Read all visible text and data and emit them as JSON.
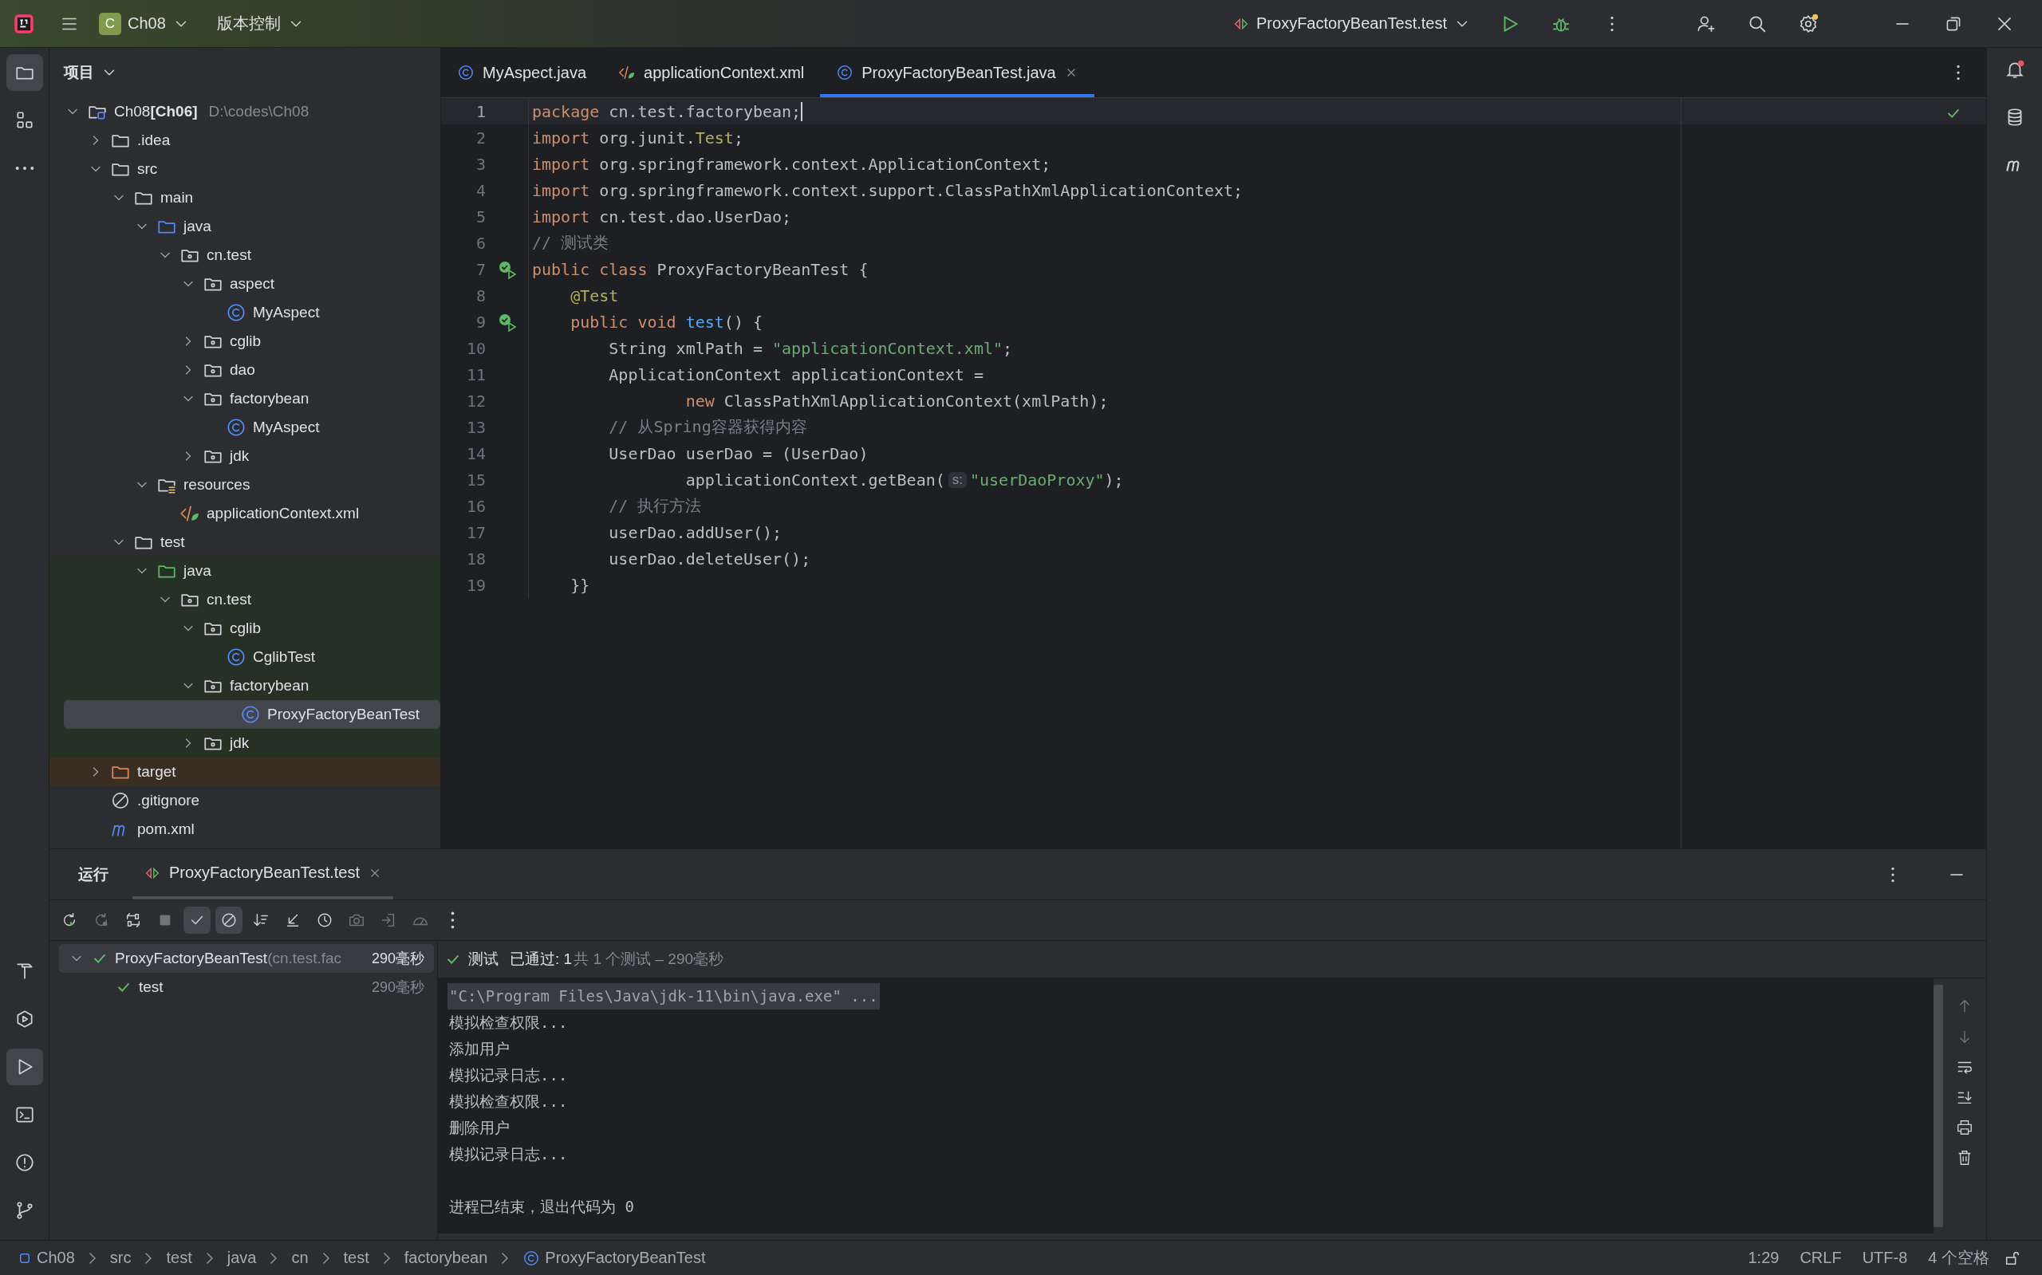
{
  "title_bar": {
    "project_badge": "C",
    "project": "Ch08",
    "vcs": "版本控制",
    "run_config": "ProxyFactoryBeanTest.test",
    "settings_notice": true
  },
  "left_toolbar": {
    "top": [
      {
        "kind": "folder",
        "selected": true
      },
      {
        "kind": "structure",
        "selected": false
      },
      {
        "kind": "more",
        "selected": false
      }
    ],
    "bottom": [
      {
        "kind": "build",
        "selected": false
      },
      {
        "kind": "services",
        "selected": false
      },
      {
        "kind": "run",
        "selected": true
      },
      {
        "kind": "terminal",
        "selected": false
      },
      {
        "kind": "problems",
        "selected": false
      },
      {
        "kind": "git",
        "selected": false
      }
    ]
  },
  "project_panel": {
    "title": "项目",
    "tree": [
      {
        "label": "Ch08",
        "module": "[Ch06]",
        "path": "D:\\codes\\Ch08",
        "kind": "module",
        "expanded": true,
        "selected": false,
        "children": [
          {
            "label": ".idea",
            "kind": "folder",
            "expanded": false,
            "selected": false
          },
          {
            "label": "src",
            "kind": "folder",
            "expanded": true,
            "selected": false,
            "children": [
              {
                "label": "main",
                "kind": "folder",
                "expanded": true,
                "selected": false,
                "children": [
                  {
                    "label": "java",
                    "kind": "src-root",
                    "expanded": true,
                    "selected": false,
                    "children": [
                      {
                        "label": "cn.test",
                        "kind": "package",
                        "expanded": true,
                        "selected": false,
                        "children": [
                          {
                            "label": "aspect",
                            "kind": "package",
                            "expanded": true,
                            "selected": false,
                            "children": [
                              {
                                "label": "MyAspect",
                                "kind": "class",
                                "selected": false
                              }
                            ]
                          },
                          {
                            "label": "cglib",
                            "kind": "package",
                            "expanded": false,
                            "selected": false
                          },
                          {
                            "label": "dao",
                            "kind": "package",
                            "expanded": false,
                            "selected": false
                          },
                          {
                            "label": "factorybean",
                            "kind": "package",
                            "expanded": true,
                            "selected": false,
                            "children": [
                              {
                                "label": "MyAspect",
                                "kind": "class",
                                "selected": false
                              }
                            ]
                          },
                          {
                            "label": "jdk",
                            "kind": "package",
                            "expanded": false,
                            "selected": false
                          }
                        ]
                      }
                    ]
                  },
                  {
                    "label": "resources",
                    "kind": "resources",
                    "expanded": true,
                    "selected": false,
                    "children": [
                      {
                        "label": "applicationContext.xml",
                        "kind": "xml",
                        "selected": false
                      }
                    ]
                  }
                ]
              },
              {
                "label": "test",
                "kind": "folder",
                "expanded": true,
                "selected": false,
                "children": [
                  {
                    "label": "java",
                    "kind": "test-root",
                    "expanded": true,
                    "selected": false,
                    "children": [
                      {
                        "label": "cn.test",
                        "kind": "package",
                        "expanded": true,
                        "selected": false,
                        "children": [
                          {
                            "label": "cglib",
                            "kind": "package",
                            "expanded": true,
                            "selected": false,
                            "children": [
                              {
                                "label": "CglibTest",
                                "kind": "class",
                                "selected": false
                              }
                            ]
                          },
                          {
                            "label": "factorybean",
                            "kind": "package",
                            "expanded": true,
                            "selected": false,
                            "children": [
                              {
                                "label": "ProxyFactoryBeanTest",
                                "kind": "class",
                                "selected": true
                              }
                            ]
                          },
                          {
                            "label": "jdk",
                            "kind": "package",
                            "expanded": false,
                            "selected": false
                          }
                        ]
                      }
                    ]
                  }
                ]
              }
            ]
          },
          {
            "label": "target",
            "kind": "excluded",
            "expanded": false,
            "selected": false
          },
          {
            "label": ".gitignore",
            "kind": "gitignore",
            "selected": false
          },
          {
            "label": "pom.xml",
            "kind": "maven",
            "selected": false
          }
        ]
      }
    ]
  },
  "editor": {
    "tabs": [
      {
        "label": "MyAspect.java",
        "kind": "class",
        "selected": false
      },
      {
        "label": "applicationContext.xml",
        "kind": "xml",
        "selected": false
      },
      {
        "label": "ProxyFactoryBeanTest.java",
        "kind": "class",
        "selected": true
      }
    ],
    "lines": [
      {
        "number": "1",
        "selected": true,
        "marker": false,
        "tokens": [
          {
            "kind": "keyword",
            "text": "package"
          },
          {
            "kind": "plain",
            "text": " cn.test.factorybean;"
          }
        ]
      },
      {
        "number": "2",
        "selected": false,
        "marker": false,
        "tokens": [
          {
            "kind": "keyword",
            "text": "import"
          },
          {
            "kind": "plain",
            "text": " org.junit."
          },
          {
            "kind": "annotation",
            "text": "Test"
          },
          {
            "kind": "plain",
            "text": ";"
          }
        ]
      },
      {
        "number": "3",
        "selected": false,
        "marker": false,
        "tokens": [
          {
            "kind": "keyword",
            "text": "import"
          },
          {
            "kind": "plain",
            "text": " org.springframework.context.ApplicationContext;"
          }
        ]
      },
      {
        "number": "4",
        "selected": false,
        "marker": false,
        "tokens": [
          {
            "kind": "keyword",
            "text": "import"
          },
          {
            "kind": "plain",
            "text": " org.springframework.context.support.ClassPathXmlApplicationContext;"
          }
        ]
      },
      {
        "number": "5",
        "selected": false,
        "marker": false,
        "tokens": [
          {
            "kind": "keyword",
            "text": "import"
          },
          {
            "kind": "plain",
            "text": " cn.test.dao.UserDao;"
          }
        ]
      },
      {
        "number": "6",
        "selected": false,
        "marker": false,
        "tokens": [
          {
            "kind": "comment",
            "text": "// 测试类"
          }
        ]
      },
      {
        "number": "7",
        "selected": false,
        "marker": true,
        "tokens": [
          {
            "kind": "keyword",
            "text": "public class"
          },
          {
            "kind": "plain",
            "text": " ProxyFactoryBeanTest {"
          }
        ]
      },
      {
        "number": "8",
        "selected": false,
        "marker": false,
        "tokens": [
          {
            "kind": "annotation",
            "text": "    @Test"
          }
        ]
      },
      {
        "number": "9",
        "selected": false,
        "marker": true,
        "tokens": [
          {
            "kind": "keyword",
            "text": "    public void"
          },
          {
            "kind": "function",
            "text": " test"
          },
          {
            "kind": "plain",
            "text": "() {"
          }
        ]
      },
      {
        "number": "10",
        "selected": false,
        "marker": false,
        "tokens": [
          {
            "kind": "plain",
            "text": "        String xmlPath = "
          },
          {
            "kind": "string",
            "text": "\"applicationContext.xml\""
          },
          {
            "kind": "plain",
            "text": ";"
          }
        ]
      },
      {
        "number": "11",
        "selected": false,
        "marker": false,
        "tokens": [
          {
            "kind": "plain",
            "text": "        ApplicationContext applicationContext ="
          }
        ]
      },
      {
        "number": "12",
        "selected": false,
        "marker": false,
        "tokens": [
          {
            "kind": "keyword",
            "text": "                new"
          },
          {
            "kind": "plain",
            "text": " ClassPathXmlApplicationContext(xmlPath);"
          }
        ]
      },
      {
        "number": "13",
        "selected": false,
        "marker": false,
        "tokens": [
          {
            "kind": "comment",
            "text": "        // 从Spring容器获得内容"
          }
        ]
      },
      {
        "number": "14",
        "selected": false,
        "marker": false,
        "tokens": [
          {
            "kind": "plain",
            "text": "        UserDao userDao = (UserDao)"
          }
        ]
      },
      {
        "number": "15",
        "selected": false,
        "marker": false,
        "tokens": [
          {
            "kind": "plain",
            "text": "                applicationContext.getBean("
          },
          {
            "kind": "hint",
            "text": "s:"
          },
          {
            "kind": "string",
            "text": "\"userDaoProxy\""
          },
          {
            "kind": "plain",
            "text": ");"
          }
        ]
      },
      {
        "number": "16",
        "selected": false,
        "marker": false,
        "tokens": [
          {
            "kind": "comment",
            "text": "        // 执行方法"
          }
        ]
      },
      {
        "number": "17",
        "selected": false,
        "marker": false,
        "tokens": [
          {
            "kind": "plain",
            "text": "        userDao.addUser();"
          }
        ]
      },
      {
        "number": "18",
        "selected": false,
        "marker": false,
        "tokens": [
          {
            "kind": "plain",
            "text": "        userDao.deleteUser();"
          }
        ]
      },
      {
        "number": "19",
        "selected": false,
        "marker": false,
        "tokens": [
          {
            "kind": "plain",
            "text": "    }}"
          }
        ]
      }
    ]
  },
  "run_panel": {
    "title": "运行",
    "tab": "ProxyFactoryBeanTest.test",
    "toolbar": [
      {
        "kind": "rerun",
        "on": false,
        "disabled": false
      },
      {
        "kind": "rerun-failed",
        "on": false,
        "disabled": true
      },
      {
        "kind": "toggle-auto",
        "on": false,
        "disabled": false
      },
      {
        "kind": "stop",
        "on": false,
        "disabled": true
      },
      {
        "kind": "show-passed",
        "on": true,
        "disabled": false
      },
      {
        "kind": "show-ignored",
        "on": true,
        "disabled": false
      },
      {
        "kind": "sort",
        "on": false,
        "disabled": false
      },
      {
        "kind": "collapse",
        "on": false,
        "disabled": false
      },
      {
        "kind": "history",
        "on": false,
        "disabled": false
      },
      {
        "kind": "camera",
        "on": false,
        "disabled": true
      },
      {
        "kind": "import",
        "on": false,
        "disabled": true
      },
      {
        "kind": "gauge",
        "on": false,
        "disabled": true
      },
      {
        "kind": "more",
        "on": false,
        "disabled": false
      }
    ],
    "tests": [
      {
        "name": "ProxyFactoryBeanTest",
        "package": "(cn.test.fac",
        "time": "290毫秒",
        "passed": true,
        "expanded": true,
        "selected": true,
        "children": [
          {
            "name": "test",
            "time": "290毫秒",
            "passed": true,
            "selected": false
          }
        ]
      }
    ],
    "summary": {
      "label": "测试",
      "status": "已通过: 1",
      "detail": "共 1 个测试 – 290毫秒",
      "passed": true
    },
    "console": [
      {
        "kind": "command",
        "text": "\"C:\\Program Files\\Java\\jdk-11\\bin\\java.exe\" ..."
      },
      {
        "kind": "output",
        "text": "模拟检查权限..."
      },
      {
        "kind": "output",
        "text": "添加用户"
      },
      {
        "kind": "output",
        "text": "模拟记录日志..."
      },
      {
        "kind": "output",
        "text": "模拟检查权限..."
      },
      {
        "kind": "output",
        "text": "删除用户"
      },
      {
        "kind": "output",
        "text": "模拟记录日志..."
      },
      {
        "kind": "exit",
        "text": "进程已结束，退出代码为 0"
      }
    ]
  },
  "status_bar": {
    "breadcrumbs": [
      {
        "label": "Ch08",
        "kind": "module"
      },
      {
        "label": "src",
        "kind": "plain"
      },
      {
        "label": "test",
        "kind": "plain"
      },
      {
        "label": "java",
        "kind": "plain"
      },
      {
        "label": "cn",
        "kind": "plain"
      },
      {
        "label": "test",
        "kind": "plain"
      },
      {
        "label": "factorybean",
        "kind": "plain"
      },
      {
        "label": "ProxyFactoryBeanTest",
        "kind": "class"
      }
    ],
    "position": "1:29",
    "line_ending": "CRLF",
    "encoding": "UTF-8",
    "indent": "4 个空格"
  },
  "notifications": {
    "unread": true
  }
}
